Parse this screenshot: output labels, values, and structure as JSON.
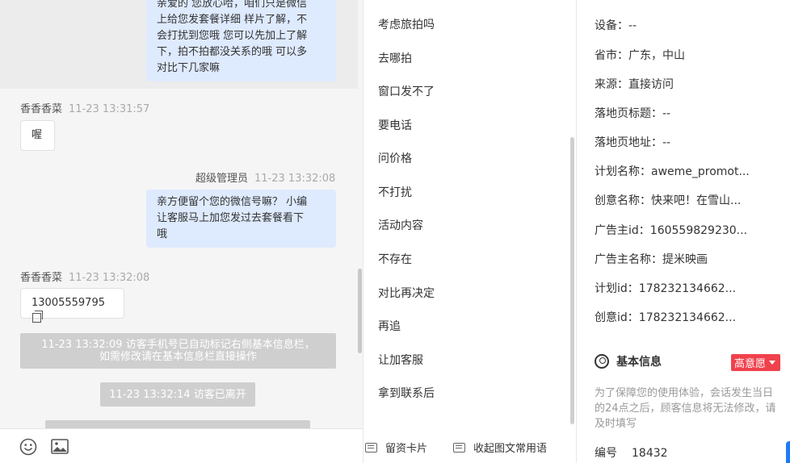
{
  "chat": {
    "messages": [
      {
        "type": "agent",
        "lines": [
          "亲爱的 您放心哈，咱们只是微信",
          "上给您发套餐详细 样片了解，不",
          "会打扰到您哦 您可以先加上了解",
          "下，拍不拍都没关系的哦 可以多",
          "对比下几家嘛"
        ]
      },
      {
        "type": "visitor",
        "sender": "香香香菜",
        "time": "11-23 13:31:57",
        "text": "喔"
      },
      {
        "type": "agent",
        "sender": "超级管理员",
        "time": "11-23 13:32:08",
        "lines": [
          "亲方便留个您的微信号嘛？ 小编",
          "让客服马上加您发过去套餐看下",
          "哦"
        ]
      },
      {
        "type": "visitor",
        "sender": "香香香菜",
        "time": "11-23 13:32:08",
        "text": "13005559795"
      },
      {
        "type": "system",
        "lines": [
          "11-23 13:32:09 访客手机号已自动标记右侧基本信息栏，",
          "如需修改请在基本信息栏直接操作"
        ]
      },
      {
        "type": "system",
        "text": "11-23 13:32:14 访客已离开"
      },
      {
        "type": "system",
        "text": "...."
      }
    ],
    "toolbar": {
      "emoji_icon": "smile-icon",
      "image_icon": "image-icon"
    }
  },
  "quick_replies": {
    "items": [
      "考虑旅拍吗",
      "去哪拍",
      "窗口发不了",
      "要电话",
      "问价格",
      "不打扰",
      "活动内容",
      "不存在",
      "对比再决定",
      "再追",
      "让加客服",
      "拿到联系后"
    ],
    "actions": [
      "留资卡片",
      "收起图文常用语"
    ]
  },
  "info": {
    "rows": [
      {
        "label": "设备：",
        "value": "--"
      },
      {
        "label": "省市：",
        "value": "广东，中山"
      },
      {
        "label": "来源：",
        "value": "直接访问"
      },
      {
        "label": "落地页标题：",
        "value": "--"
      },
      {
        "label": "落地页地址：",
        "value": "--"
      },
      {
        "label": "计划名称：",
        "value": "aweme_promot..."
      },
      {
        "label": "创意名称：",
        "value": "快来吧！在雪山..."
      },
      {
        "label": "广告主id：",
        "value": "160559829230..."
      },
      {
        "label": "广告主名称：",
        "value": "提米映画"
      },
      {
        "label": "计划id：",
        "value": "178232134662..."
      },
      {
        "label": "创意id：",
        "value": "178232134662..."
      }
    ],
    "section_title": "基本信息",
    "badge": "高意愿",
    "notice": "为了保障您的使用体验，会话发生当日的24点之后，顾客信息将无法修改，请及时填写",
    "id_label": "编号",
    "id_value": "18432"
  },
  "colors": {
    "agent_bubble": "#deeafe",
    "badge": "#f0424c",
    "accent": "#1e7cf2"
  }
}
